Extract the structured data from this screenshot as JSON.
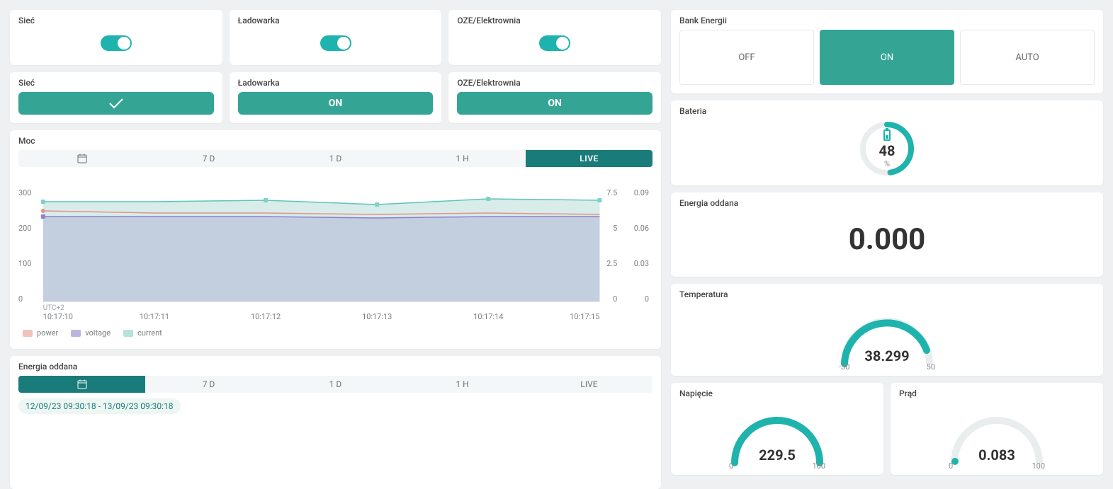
{
  "toggles": [
    {
      "label": "Sieć",
      "on": true
    },
    {
      "label": "Ładowarka",
      "on": true
    },
    {
      "label": "OZE/Elektrownia",
      "on": true
    }
  ],
  "status": [
    {
      "label": "Sieć",
      "text": "",
      "icon": "check"
    },
    {
      "label": "Ładowarka",
      "text": "ON",
      "icon": null
    },
    {
      "label": "OZE/Elektrownia",
      "text": "ON",
      "icon": null
    }
  ],
  "bank": {
    "title": "Bank Energii",
    "buttons": [
      {
        "label": "OFF",
        "active": false
      },
      {
        "label": "ON",
        "active": true
      },
      {
        "label": "AUTO",
        "active": false
      }
    ]
  },
  "power_chart": {
    "title": "Moc",
    "ranges": [
      "calendar",
      "7 D",
      "1 D",
      "1 H",
      "LIVE"
    ],
    "active_range": "LIVE",
    "utc": "UTC+2",
    "x_labels": [
      "10:17:10",
      "10:17:11",
      "10:17:12",
      "10:17:13",
      "10:17:14",
      "10:17:15"
    ],
    "y_left": [
      "300",
      "200",
      "100",
      "0"
    ],
    "y_mid": [
      "7.5",
      "5",
      "2.5",
      "0"
    ],
    "y_right": [
      "0.09",
      "0.06",
      "0.03",
      "0"
    ],
    "legend": [
      {
        "label": "power",
        "color": "#f1a7a0"
      },
      {
        "label": "voltage",
        "color": "#a39bd6"
      },
      {
        "label": "current",
        "color": "#a3d9d4"
      }
    ]
  },
  "chart_data": {
    "type": "line",
    "x": [
      "10:17:10",
      "10:17:11",
      "10:17:12",
      "10:17:13",
      "10:17:14",
      "10:17:15"
    ],
    "series": [
      {
        "name": "power",
        "values": [
          250,
          245,
          245,
          240,
          245,
          240
        ],
        "axis": "left"
      },
      {
        "name": "voltage",
        "values": [
          230,
          230,
          230,
          225,
          230,
          230
        ],
        "axis": "left"
      },
      {
        "name": "current",
        "values": [
          6.8,
          6.8,
          6.9,
          6.6,
          7.0,
          6.9
        ],
        "axis": "mid"
      }
    ],
    "axes": {
      "left": {
        "min": 0,
        "max": 300
      },
      "mid": {
        "min": 0,
        "max": 7.5
      },
      "right": {
        "min": 0,
        "max": 0.09
      }
    }
  },
  "energy_out_chart": {
    "title": "Energia oddana",
    "ranges": [
      "calendar",
      "7 D",
      "1 D",
      "1 H",
      "LIVE"
    ],
    "active_range": "calendar",
    "date_range": "12/09/23 09:30:18 - 13/09/23 09:30:18"
  },
  "battery": {
    "title": "Bateria",
    "value": "48",
    "unit": "%",
    "percent": 48
  },
  "energy_out": {
    "title": "Energia oddana",
    "value": "0.000"
  },
  "temperature": {
    "title": "Temperatura",
    "value": "38.299",
    "min": "-30",
    "max": "50",
    "percent": 85
  },
  "voltage": {
    "title": "Napięcie",
    "value": "229.5",
    "min": "0",
    "max": "100",
    "percent": 100
  },
  "current": {
    "title": "Prąd",
    "value": "0.083",
    "min": "0",
    "max": "100",
    "percent": 1
  }
}
